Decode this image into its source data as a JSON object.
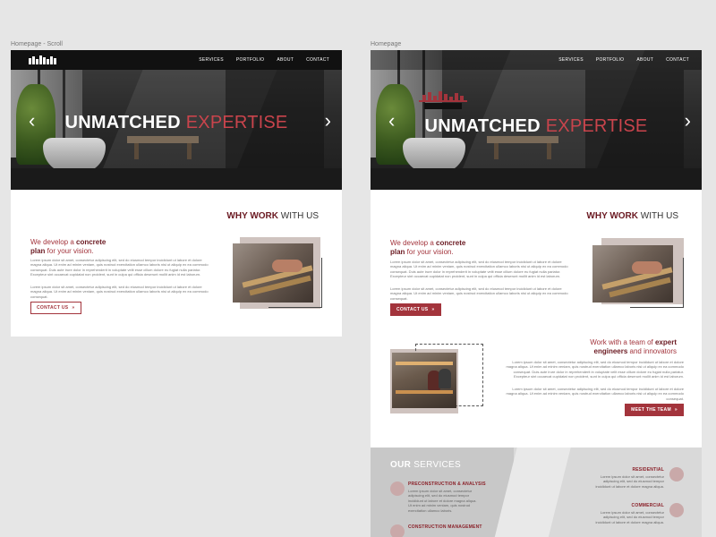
{
  "frames": {
    "scroll_label": "Homepage - Scroll",
    "home_label": "Homepage"
  },
  "nav": {
    "items": [
      "SERVICES",
      "PORTFOLIO",
      "ABOUT",
      "CONTACT"
    ]
  },
  "hero": {
    "title_main": "UNMATCHED",
    "title_accent": "EXPERTISE",
    "prev_arrow": "‹",
    "next_arrow": "›"
  },
  "why": {
    "title_bold": "WHY WORK",
    "title_rest": " WITH US",
    "lead_pre": "We develop a ",
    "lead_bold1": "concrete",
    "lead_bold2": "plan",
    "lead_post": " for your vision.",
    "para1": "Lorem ipsum dolor sit amet, consectetur adipiscing elit, sed do eiusmod tempor incididunt ut labore et dolore magna aliqua. Ut enim ad minim veniam, quis nostrud exercitation ullamco laboris nisi ut aliquip ex ea commodo consequat. Duis aute irure dolor in reprehenderit in voluptate velit esse cillum dolore eu fugiat nulla pariatur. Excepteur sint occaecat cupidatat non proident, sunt in culpa qui officia deserunt mollit anim id est laborum.",
    "para2": "Lorem ipsum dolor sit amet, consectetur adipiscing elit, sed do eiusmod tempor incididunt ut labore et dolore magna aliqua. Ut enim ad minim veniam, quis nostrud exercitation ullamco laboris nisi ut aliquip ex ea commodo consequat.",
    "cta": "CONTACT US",
    "cta_icon": "»"
  },
  "team": {
    "title_pre": "Work with a team of ",
    "title_bold1": "expert",
    "title_bold2": "engineers",
    "title_post": " and innovators",
    "para1": "Lorem ipsum dolor sit amet, consectetur adipiscing elit, sed do eiusmod tempor incididunt ut labore et dolore magna aliqua. Ut enim ad minim veniam, quis nostrud exercitation ullamco laboris nisi ut aliquip ex ea commodo consequat. Duis aute irure dolor in reprehenderit in voluptate velit esse cillum dolore eu fugiat nulla pariatur. Excepteur sint occaecat cupidatat non proident, sunt in culpa qui officia deserunt mollit anim id est laborum.",
    "para2": "Lorem ipsum dolor sit amet, consectetur adipiscing elit, sed do eiusmod tempor incididunt ut labore et dolore magna aliqua. Ut enim ad minim veniam, quis nostrud exercitation ullamco laboris nisi ut aliquip ex ea commodo consequat.",
    "cta": "MEET THE TEAM",
    "cta_icon": "»"
  },
  "services": {
    "title_bold": "OUR",
    "title_rest": " SERVICES",
    "items": [
      {
        "name": "PRECONSTRUCTION & ANALYSIS",
        "desc": "Lorem ipsum dolor sit amet, consectetur adipiscing elit, sed do eiusmod tempor incididunt ut labore et dolore magna aliqua. Ut enim ad minim veniam, quis nostrud exercitation ullamco laboris."
      },
      {
        "name": "CONSTRUCTION MANAGEMENT",
        "desc": ""
      },
      {
        "name": "RESIDENTIAL",
        "desc": "Lorem ipsum dolor sit amet, consectetur adipiscing elit, sed do eiusmod tempor incididunt ut labore et dolore magna aliqua."
      },
      {
        "name": "COMMERCIAL",
        "desc": "Lorem ipsum dolor sit amet, consectetur adipiscing elit, sed do eiusmod tempor incididunt ut labore et dolore magna aliqua."
      }
    ]
  },
  "colors": {
    "accent": "#a3343c",
    "accent_dark": "#6b1a22",
    "nav_bg": "#111111"
  },
  "icons": {
    "logo": "company-logo-skyline",
    "cta_arrow": "double-chevron-right-icon"
  }
}
